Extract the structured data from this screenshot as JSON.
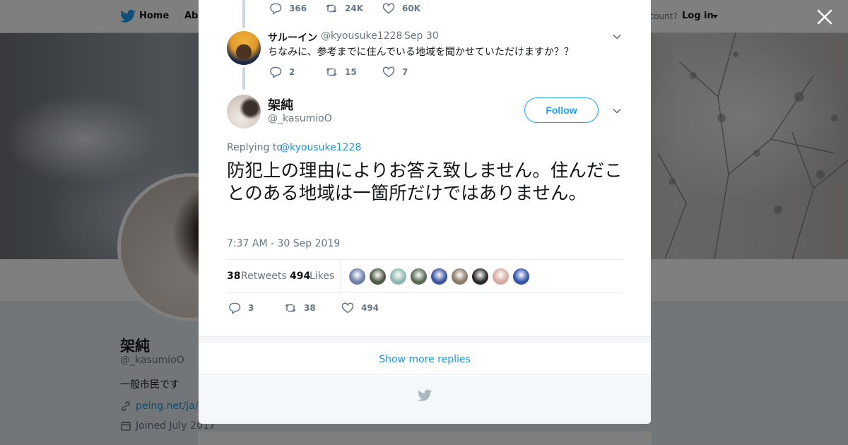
{
  "topbar": {
    "home_label": "Home",
    "about_label": "Abo",
    "account_text": "ccount?",
    "login_label": "Log in"
  },
  "profile": {
    "name": "架純",
    "handle": "@_kasumioO",
    "bio": "一般市民です",
    "link": "peing.net/ja/_k",
    "joined": "Joined July 2017"
  },
  "parent_tweet": {
    "replies": "366",
    "retweets": "24K",
    "likes": "60K"
  },
  "reply_tweet": {
    "name": "サルーイン",
    "handle": "@kyousuke1228",
    "dot": "·",
    "time": "Sep 30",
    "text": "ちなみに、参考までに住んでいる地域を聞かせていただけますか？？",
    "replies": "2",
    "retweets": "15",
    "likes": "7"
  },
  "main_tweet": {
    "name": "架純",
    "handle": "@_kasumioO",
    "follow_label": "Follow",
    "replying_label": "Replying to",
    "replying_to": "@kyousuke1228",
    "text": "防犯上の理由によりお答え致しません。住んだことのある地域は一箇所だけではありません。",
    "timestamp": "7:37 AM - 30 Sep 2019",
    "retweet_count": "38",
    "retweet_label": "Retweets",
    "like_count": "494",
    "like_label": "Likes",
    "replies": "3",
    "retweets": "38",
    "likes": "494"
  },
  "show_more_label": "Show more replies",
  "colors": {
    "twitter_blue": "#1da1f2",
    "link_blue": "#1b95e0",
    "muted": "#657786",
    "text": "#14171a"
  },
  "liker_avatar_colors": [
    "#6b7fa8",
    "#4d5a46",
    "#8fb7b0",
    "#5a6a52",
    "#3b55a0",
    "#8a7a6a",
    "#2a2a2a",
    "#d8a8a0",
    "#3355aa"
  ]
}
